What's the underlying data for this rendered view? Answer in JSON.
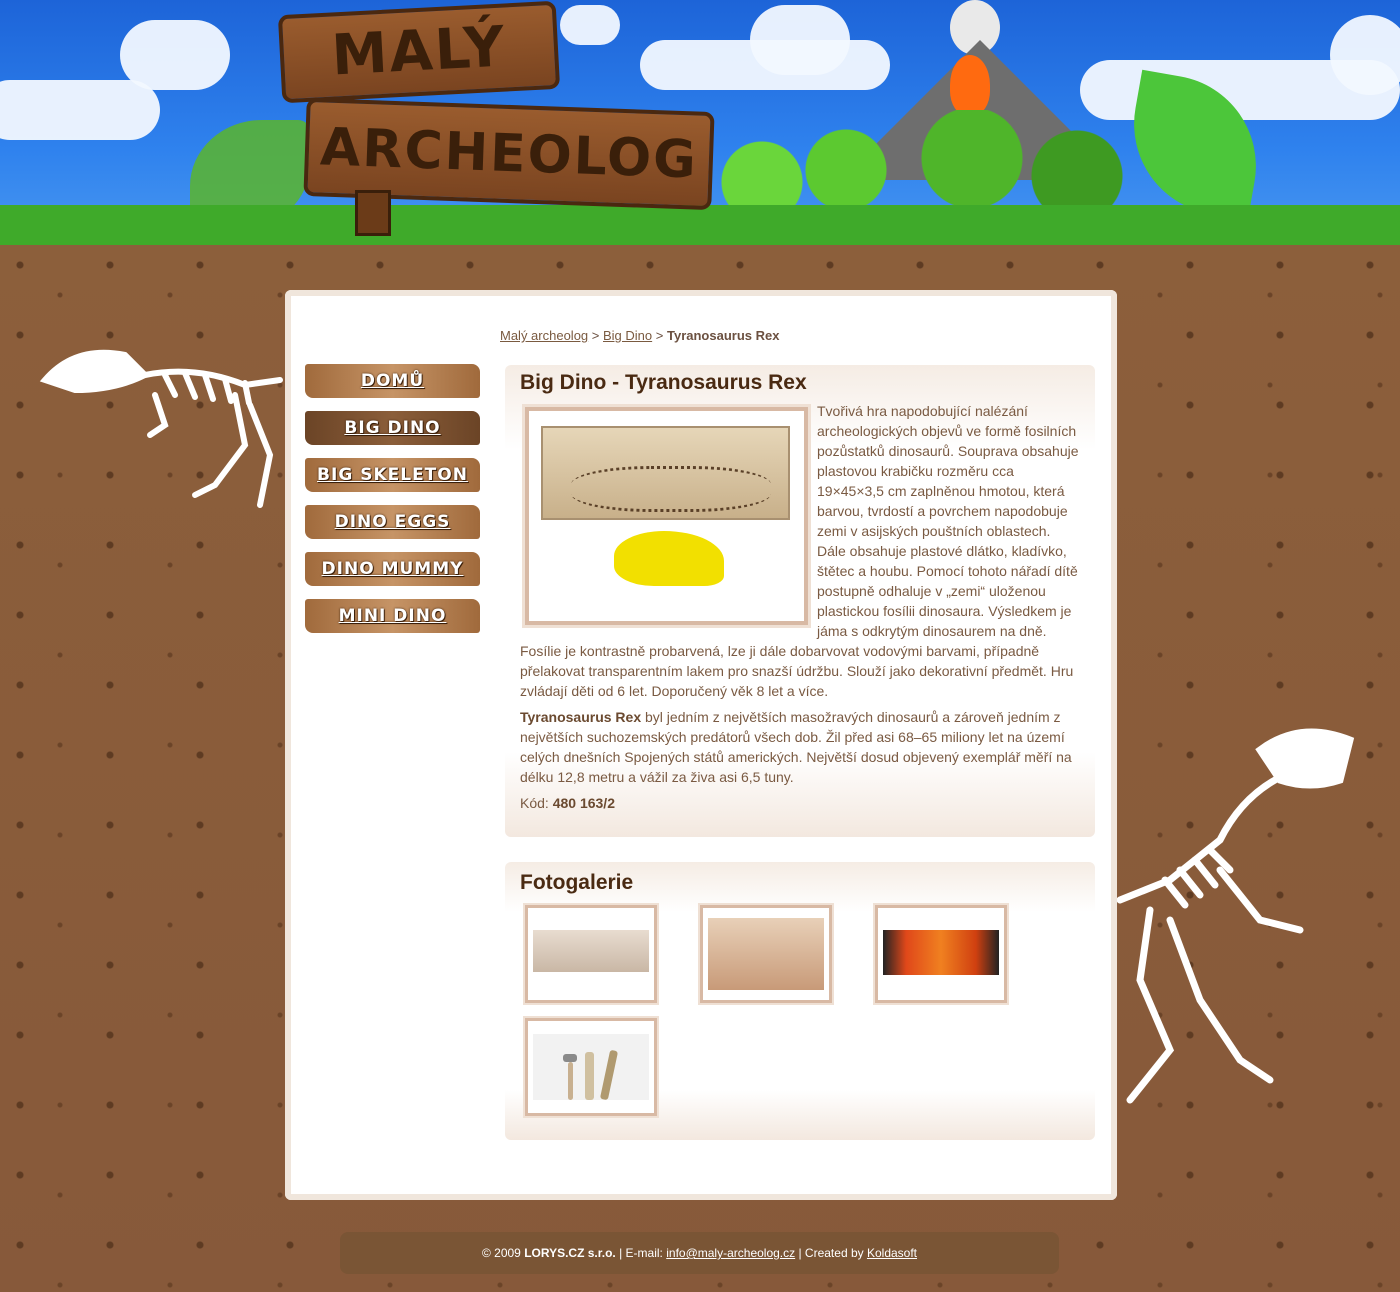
{
  "header": {
    "logo_line1": "MALÝ",
    "logo_line2": "ARCHEOLOG"
  },
  "breadcrumb": {
    "home": "Malý archeolog",
    "separator": ">",
    "parent": "Big Dino",
    "current": "Tyranosaurus Rex"
  },
  "menu": {
    "items": [
      {
        "label": "DOMŮ"
      },
      {
        "label": "BIG DINO"
      },
      {
        "label": "BIG SKELETON"
      },
      {
        "label": "DINO EGGS"
      },
      {
        "label": "DINO MUMMY"
      },
      {
        "label": "MINI DINO"
      }
    ]
  },
  "article": {
    "title": "Big Dino - Tyranosaurus Rex",
    "paragraph1": "Tvořivá hra napodobující nalézání archeologických objevů ve formě fosilních pozůstatků dinosaurů. Souprava obsahuje plastovou krabičku rozměru cca 19×45×3,5 cm zaplněnou hmotou, která barvou, tvrdostí a povrchem napodobuje zemi v asijských pouštních oblastech. Dále obsahuje plastové dlátko, kladívko, štětec a houbu. Pomocí tohoto nářadí dítě postupně odhaluje v „zemi“ uloženou plastickou fosílii dinosaura. Výsledkem je jáma s odkrytým dinosaurem na dně. Fosílie je kontrastně probarvená, lze ji dále dobarvovat vodovými barvami, případně přelakovat transparentním lakem pro snazší údržbu. Slouží jako dekorativní předmět. Hru zvládají děti od 6 let. Doporučený věk 8 let a více.",
    "paragraph2_bold": "Tyranosaurus Rex",
    "paragraph2_rest": " byl jedním z největších masožravých dinosaurů a zároveň jedním z největších suchozemských predátorů všech dob. Žil před asi 68–65 miliony let na území celých dnešních Spojených států amerických. Největší dosud objevený exemplář měří na délku 12,8 metru a vážil za živa asi 6,5 tuny.",
    "code_label": "Kód:",
    "code_value": "480 163/2"
  },
  "gallery": {
    "title": "Fotogalerie"
  },
  "footer": {
    "copyright": "© 2009",
    "company": "LORYS.CZ s.r.o.",
    "email_label": " | E-mail:",
    "email": "info@maly-archeolog.cz",
    "created_label": " | Created by",
    "created_by": "Koldasoft"
  },
  "colors": {
    "soil": "#8a5e3a",
    "sky": "#2f82ee",
    "menu_button": "#b07a4a",
    "menu_active": "#7a5030",
    "title_text": "#4a2a12",
    "body_text": "#7a5a42",
    "footer_bg": "#7a5535"
  },
  "icons": [
    "fossil-image",
    "t-rex-skeleton-left",
    "t-rex-skeleton-right",
    "volcano",
    "wooden-sign-logo"
  ]
}
